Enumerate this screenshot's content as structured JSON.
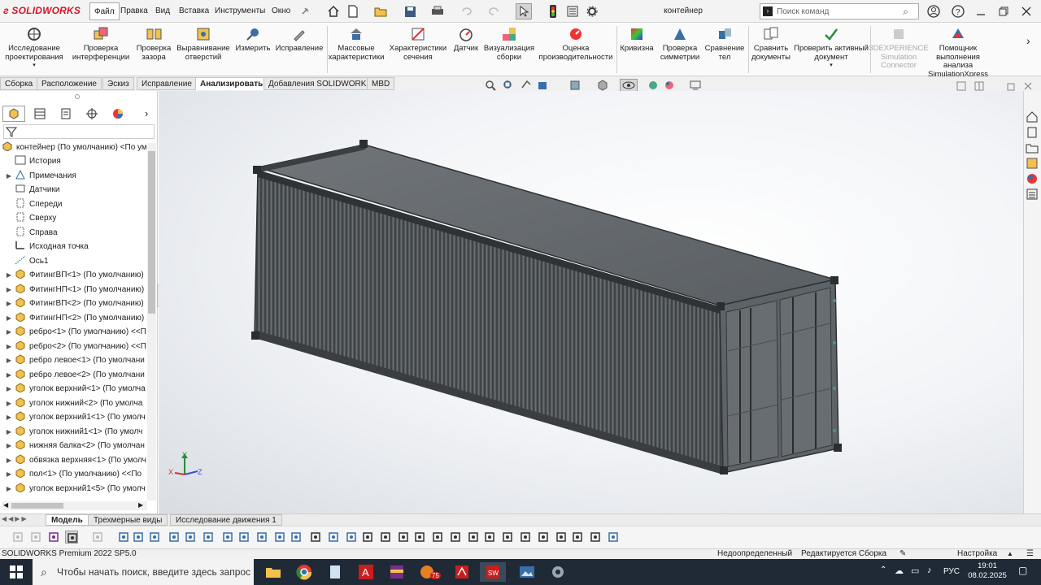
{
  "app": {
    "logo": "SOLIDWORKS",
    "title": "контейнер"
  },
  "menu": [
    "Файл",
    "Правка",
    "Вид",
    "Вставка",
    "Инструменты",
    "Окно"
  ],
  "search": {
    "placeholder": "Поиск команд"
  },
  "commands": [
    {
      "label": "Исследование проектирования",
      "icon": "design-study-icon"
    },
    {
      "label": "Проверка интерференции",
      "icon": "interference-icon"
    },
    {
      "label": "Проверка зазора",
      "icon": "clearance-icon"
    },
    {
      "label": "Выравнивание отверстий",
      "icon": "hole-align-icon"
    },
    {
      "label": "Измерить",
      "icon": "measure-icon"
    },
    {
      "label": "Исправление",
      "icon": "repair-icon"
    },
    {
      "label": "Массовые характеристики",
      "icon": "mass-props-icon"
    },
    {
      "label": "Характеристики сечения",
      "icon": "section-props-icon"
    },
    {
      "label": "Датчик",
      "icon": "sensor-icon"
    },
    {
      "label": "Визуализация сборки",
      "icon": "assembly-vis-icon"
    },
    {
      "label": "Оценка производительности",
      "icon": "performance-icon"
    },
    {
      "label": "Кривизна",
      "icon": "curvature-icon"
    },
    {
      "label": "Проверка симметрии",
      "icon": "symmetry-icon"
    },
    {
      "label": "Сравнение тел",
      "icon": "compare-bodies-icon"
    },
    {
      "label": "Сравнить документы",
      "icon": "compare-docs-icon"
    },
    {
      "label": "Проверить активный документ",
      "icon": "check-doc-icon"
    },
    {
      "label": "3DEXPERIENCE Simulation Connector",
      "icon": "3dx-icon",
      "disabled": true
    },
    {
      "label": "Помощник выполнения анализа SimulationXpress",
      "icon": "simxpress-icon"
    }
  ],
  "tabs": [
    "Сборка",
    "Расположение",
    "Эскиз",
    "Исправление",
    "Анализировать",
    "Добавления SOLIDWORKS",
    "MBD"
  ],
  "active_tab": "Анализировать",
  "tree": {
    "root": "контейнер (По умолчанию) <По ум",
    "items": [
      {
        "label": "История",
        "expand": false
      },
      {
        "label": "Примечания",
        "expand": true
      },
      {
        "label": "Датчики",
        "expand": false
      },
      {
        "label": "Спереди",
        "expand": false
      },
      {
        "label": "Сверху",
        "expand": false
      },
      {
        "label": "Справа",
        "expand": false
      },
      {
        "label": "Исходная точка",
        "expand": false
      },
      {
        "label": "Ось1",
        "expand": false
      },
      {
        "label": "ФитингВП<1> (По умолчанию)",
        "expand": true
      },
      {
        "label": "ФитингНП<1> (По умолчанию)",
        "expand": true
      },
      {
        "label": "ФитингВП<2> (По умолчанию)",
        "expand": true
      },
      {
        "label": "ФитингНП<2> (По умолчанию)",
        "expand": true
      },
      {
        "label": "ребро<1> (По умолчанию) <<П",
        "expand": true
      },
      {
        "label": "ребро<2> (По умолчанию) <<П",
        "expand": true
      },
      {
        "label": "ребро левое<1> (По умолчани",
        "expand": true
      },
      {
        "label": "ребро левое<2> (По умолчани",
        "expand": true
      },
      {
        "label": "уголок верхний<1> (По умолча",
        "expand": true
      },
      {
        "label": "уголок нижний<2> (По умолча",
        "expand": true
      },
      {
        "label": "уголок верхний1<1> (По умолч",
        "expand": true
      },
      {
        "label": "уголок нижний1<1> (По умолч",
        "expand": true
      },
      {
        "label": "нижняя балка<2> (По умолчан",
        "expand": true
      },
      {
        "label": "обвязка верхняя<1> (По умолч",
        "expand": true
      },
      {
        "label": "пол<1> (По умолчанию) <<По",
        "expand": true
      },
      {
        "label": "уголок верхний1<5> (По умолч",
        "expand": true
      }
    ]
  },
  "bottom_tabs": [
    "Модель",
    "Трехмерные виды",
    "Исследование движения 1"
  ],
  "status": {
    "version": "SOLIDWORKS Premium 2022 SP5.0",
    "state": "Недоопределенный",
    "mode": "Редактируется Сборка",
    "settings": "Настройка"
  },
  "taskbar": {
    "search_placeholder": "Чтобы начать поиск, введите здесь запрос",
    "lang": "РУС",
    "time": "19:01",
    "date": "08.02.2025",
    "badge": "75"
  },
  "triad": {
    "x": "X",
    "y": "Y",
    "z": "Z"
  }
}
